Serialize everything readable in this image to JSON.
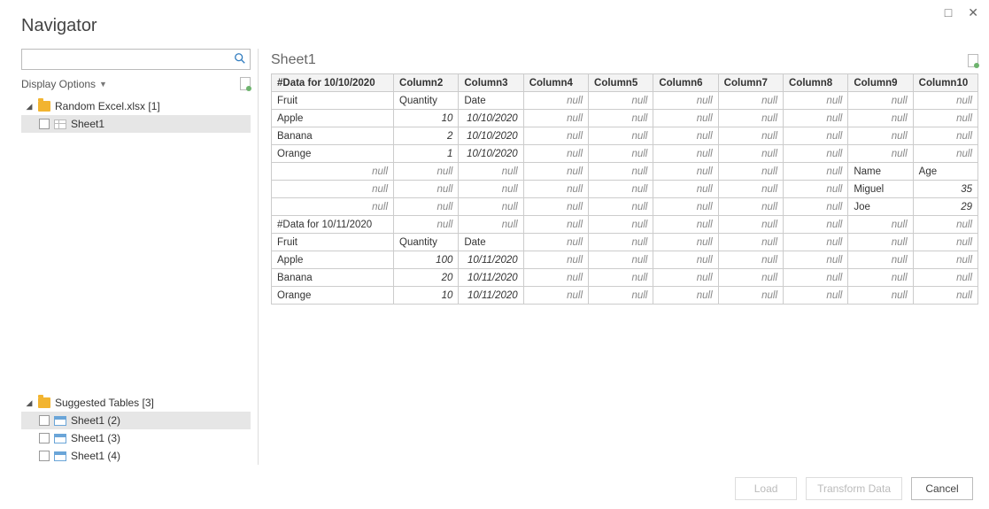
{
  "title": "Navigator",
  "window": {
    "maximize": "□",
    "close": "✕"
  },
  "search": {
    "placeholder": ""
  },
  "display_options": {
    "label": "Display Options"
  },
  "tree": {
    "file": {
      "label": "Random Excel.xlsx [1]"
    },
    "sheet": {
      "label": "Sheet1"
    },
    "suggested": {
      "label": "Suggested Tables [3]",
      "items": [
        {
          "label": "Sheet1 (2)"
        },
        {
          "label": "Sheet1 (3)"
        },
        {
          "label": "Sheet1 (4)"
        }
      ]
    }
  },
  "preview": {
    "title": "Sheet1"
  },
  "grid": {
    "headers": [
      "#Data for 10/10/2020",
      "Column2",
      "Column3",
      "Column4",
      "Column5",
      "Column6",
      "Column7",
      "Column8",
      "Column9",
      "Column10"
    ],
    "rows": [
      [
        {
          "v": "Fruit",
          "t": "txt"
        },
        {
          "v": "Quantity",
          "t": "txt"
        },
        {
          "v": "Date",
          "t": "txt"
        },
        {
          "v": "null",
          "t": "null"
        },
        {
          "v": "null",
          "t": "null"
        },
        {
          "v": "null",
          "t": "null"
        },
        {
          "v": "null",
          "t": "null"
        },
        {
          "v": "null",
          "t": "null"
        },
        {
          "v": "null",
          "t": "null"
        },
        {
          "v": "null",
          "t": "null"
        }
      ],
      [
        {
          "v": "Apple",
          "t": "txt"
        },
        {
          "v": "10",
          "t": "num"
        },
        {
          "v": "10/10/2020",
          "t": "num"
        },
        {
          "v": "null",
          "t": "null"
        },
        {
          "v": "null",
          "t": "null"
        },
        {
          "v": "null",
          "t": "null"
        },
        {
          "v": "null",
          "t": "null"
        },
        {
          "v": "null",
          "t": "null"
        },
        {
          "v": "null",
          "t": "null"
        },
        {
          "v": "null",
          "t": "null"
        }
      ],
      [
        {
          "v": "Banana",
          "t": "txt"
        },
        {
          "v": "2",
          "t": "num"
        },
        {
          "v": "10/10/2020",
          "t": "num"
        },
        {
          "v": "null",
          "t": "null"
        },
        {
          "v": "null",
          "t": "null"
        },
        {
          "v": "null",
          "t": "null"
        },
        {
          "v": "null",
          "t": "null"
        },
        {
          "v": "null",
          "t": "null"
        },
        {
          "v": "null",
          "t": "null"
        },
        {
          "v": "null",
          "t": "null"
        }
      ],
      [
        {
          "v": "Orange",
          "t": "txt"
        },
        {
          "v": "1",
          "t": "num"
        },
        {
          "v": "10/10/2020",
          "t": "num"
        },
        {
          "v": "null",
          "t": "null"
        },
        {
          "v": "null",
          "t": "null"
        },
        {
          "v": "null",
          "t": "null"
        },
        {
          "v": "null",
          "t": "null"
        },
        {
          "v": "null",
          "t": "null"
        },
        {
          "v": "null",
          "t": "null"
        },
        {
          "v": "null",
          "t": "null"
        }
      ],
      [
        {
          "v": "null",
          "t": "null"
        },
        {
          "v": "null",
          "t": "null"
        },
        {
          "v": "null",
          "t": "null"
        },
        {
          "v": "null",
          "t": "null"
        },
        {
          "v": "null",
          "t": "null"
        },
        {
          "v": "null",
          "t": "null"
        },
        {
          "v": "null",
          "t": "null"
        },
        {
          "v": "null",
          "t": "null"
        },
        {
          "v": "Name",
          "t": "txt"
        },
        {
          "v": "Age",
          "t": "txt"
        }
      ],
      [
        {
          "v": "null",
          "t": "null"
        },
        {
          "v": "null",
          "t": "null"
        },
        {
          "v": "null",
          "t": "null"
        },
        {
          "v": "null",
          "t": "null"
        },
        {
          "v": "null",
          "t": "null"
        },
        {
          "v": "null",
          "t": "null"
        },
        {
          "v": "null",
          "t": "null"
        },
        {
          "v": "null",
          "t": "null"
        },
        {
          "v": "Miguel",
          "t": "txt"
        },
        {
          "v": "35",
          "t": "num"
        }
      ],
      [
        {
          "v": "null",
          "t": "null"
        },
        {
          "v": "null",
          "t": "null"
        },
        {
          "v": "null",
          "t": "null"
        },
        {
          "v": "null",
          "t": "null"
        },
        {
          "v": "null",
          "t": "null"
        },
        {
          "v": "null",
          "t": "null"
        },
        {
          "v": "null",
          "t": "null"
        },
        {
          "v": "null",
          "t": "null"
        },
        {
          "v": "Joe",
          "t": "txt"
        },
        {
          "v": "29",
          "t": "num"
        }
      ],
      [
        {
          "v": "#Data for 10/11/2020",
          "t": "txt"
        },
        {
          "v": "null",
          "t": "null"
        },
        {
          "v": "null",
          "t": "null"
        },
        {
          "v": "null",
          "t": "null"
        },
        {
          "v": "null",
          "t": "null"
        },
        {
          "v": "null",
          "t": "null"
        },
        {
          "v": "null",
          "t": "null"
        },
        {
          "v": "null",
          "t": "null"
        },
        {
          "v": "null",
          "t": "null"
        },
        {
          "v": "null",
          "t": "null"
        }
      ],
      [
        {
          "v": "Fruit",
          "t": "txt"
        },
        {
          "v": "Quantity",
          "t": "txt"
        },
        {
          "v": "Date",
          "t": "txt"
        },
        {
          "v": "null",
          "t": "null"
        },
        {
          "v": "null",
          "t": "null"
        },
        {
          "v": "null",
          "t": "null"
        },
        {
          "v": "null",
          "t": "null"
        },
        {
          "v": "null",
          "t": "null"
        },
        {
          "v": "null",
          "t": "null"
        },
        {
          "v": "null",
          "t": "null"
        }
      ],
      [
        {
          "v": "Apple",
          "t": "txt"
        },
        {
          "v": "100",
          "t": "num"
        },
        {
          "v": "10/11/2020",
          "t": "num"
        },
        {
          "v": "null",
          "t": "null"
        },
        {
          "v": "null",
          "t": "null"
        },
        {
          "v": "null",
          "t": "null"
        },
        {
          "v": "null",
          "t": "null"
        },
        {
          "v": "null",
          "t": "null"
        },
        {
          "v": "null",
          "t": "null"
        },
        {
          "v": "null",
          "t": "null"
        }
      ],
      [
        {
          "v": "Banana",
          "t": "txt"
        },
        {
          "v": "20",
          "t": "num"
        },
        {
          "v": "10/11/2020",
          "t": "num"
        },
        {
          "v": "null",
          "t": "null"
        },
        {
          "v": "null",
          "t": "null"
        },
        {
          "v": "null",
          "t": "null"
        },
        {
          "v": "null",
          "t": "null"
        },
        {
          "v": "null",
          "t": "null"
        },
        {
          "v": "null",
          "t": "null"
        },
        {
          "v": "null",
          "t": "null"
        }
      ],
      [
        {
          "v": "Orange",
          "t": "txt"
        },
        {
          "v": "10",
          "t": "num"
        },
        {
          "v": "10/11/2020",
          "t": "num"
        },
        {
          "v": "null",
          "t": "null"
        },
        {
          "v": "null",
          "t": "null"
        },
        {
          "v": "null",
          "t": "null"
        },
        {
          "v": "null",
          "t": "null"
        },
        {
          "v": "null",
          "t": "null"
        },
        {
          "v": "null",
          "t": "null"
        },
        {
          "v": "null",
          "t": "null"
        }
      ]
    ]
  },
  "footer": {
    "load": "Load",
    "transform": "Transform Data",
    "cancel": "Cancel"
  }
}
